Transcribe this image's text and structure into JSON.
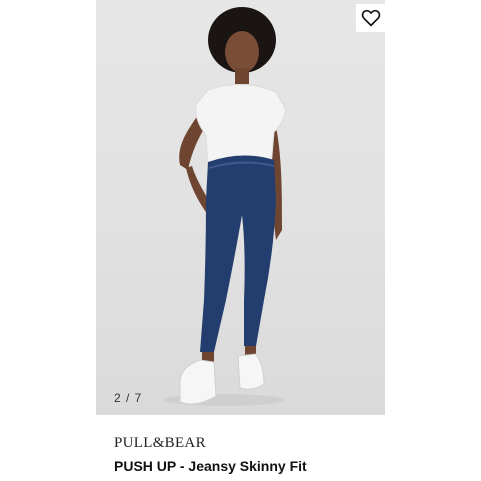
{
  "gallery": {
    "counter": "2 / 7",
    "image_alt": "Model wearing white sleeveless top and dark blue skinny jeans with white sneakers"
  },
  "favorite": {
    "icon": "heart-icon"
  },
  "product": {
    "brand": "PULL&BEAR",
    "name": "PUSH UP - Jeansy Skinny Fit"
  },
  "colors": {
    "background": "#ffffff",
    "photo_background": "#e3e3e3",
    "denim": "#233e6e",
    "text": "#111111"
  }
}
